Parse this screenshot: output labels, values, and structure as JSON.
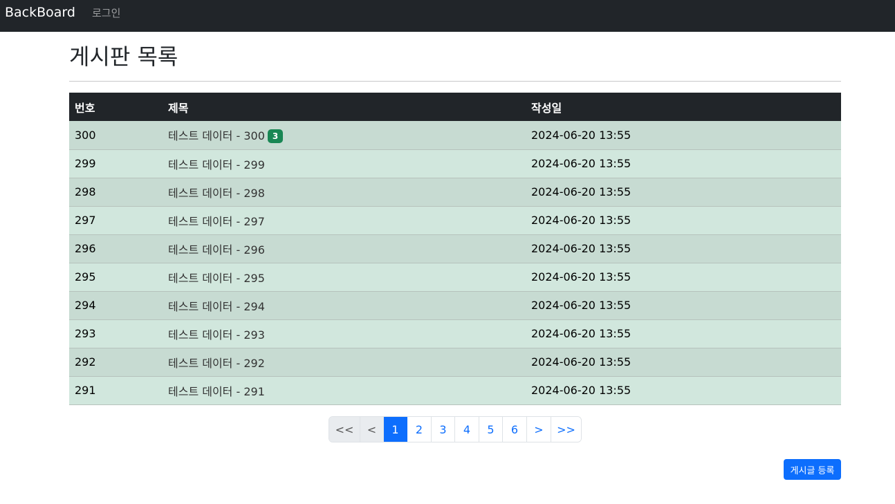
{
  "navbar": {
    "brand": "BackBoard",
    "login": "로그인"
  },
  "page": {
    "title": "게시판 목록"
  },
  "table": {
    "headers": {
      "no": "번호",
      "title": "제목",
      "date": "작성일"
    },
    "rows": [
      {
        "no": "300",
        "title": "테스트 데이터 - 300",
        "badge": "3",
        "date": "2024-06-20 13:55"
      },
      {
        "no": "299",
        "title": "테스트 데이터 - 299",
        "date": "2024-06-20 13:55"
      },
      {
        "no": "298",
        "title": "테스트 데이터 - 298",
        "date": "2024-06-20 13:55"
      },
      {
        "no": "297",
        "title": "테스트 데이터 - 297",
        "date": "2024-06-20 13:55"
      },
      {
        "no": "296",
        "title": "테스트 데이터 - 296",
        "date": "2024-06-20 13:55"
      },
      {
        "no": "295",
        "title": "테스트 데이터 - 295",
        "date": "2024-06-20 13:55"
      },
      {
        "no": "294",
        "title": "테스트 데이터 - 294",
        "date": "2024-06-20 13:55"
      },
      {
        "no": "293",
        "title": "테스트 데이터 - 293",
        "date": "2024-06-20 13:55"
      },
      {
        "no": "292",
        "title": "테스트 데이터 - 292",
        "date": "2024-06-20 13:55"
      },
      {
        "no": "291",
        "title": "테스트 데이터 - 291",
        "date": "2024-06-20 13:55"
      }
    ]
  },
  "pagination": {
    "first": "<<",
    "prev": "<",
    "next": ">",
    "last": ">>",
    "pages": [
      "1",
      "2",
      "3",
      "4",
      "5",
      "6"
    ],
    "current": "1"
  },
  "actions": {
    "write": "게시글 등록"
  },
  "colors": {
    "navbar": "#212529",
    "primary": "#0d6efd",
    "badge": "#198754",
    "row_tint": "#d1e7dd"
  }
}
